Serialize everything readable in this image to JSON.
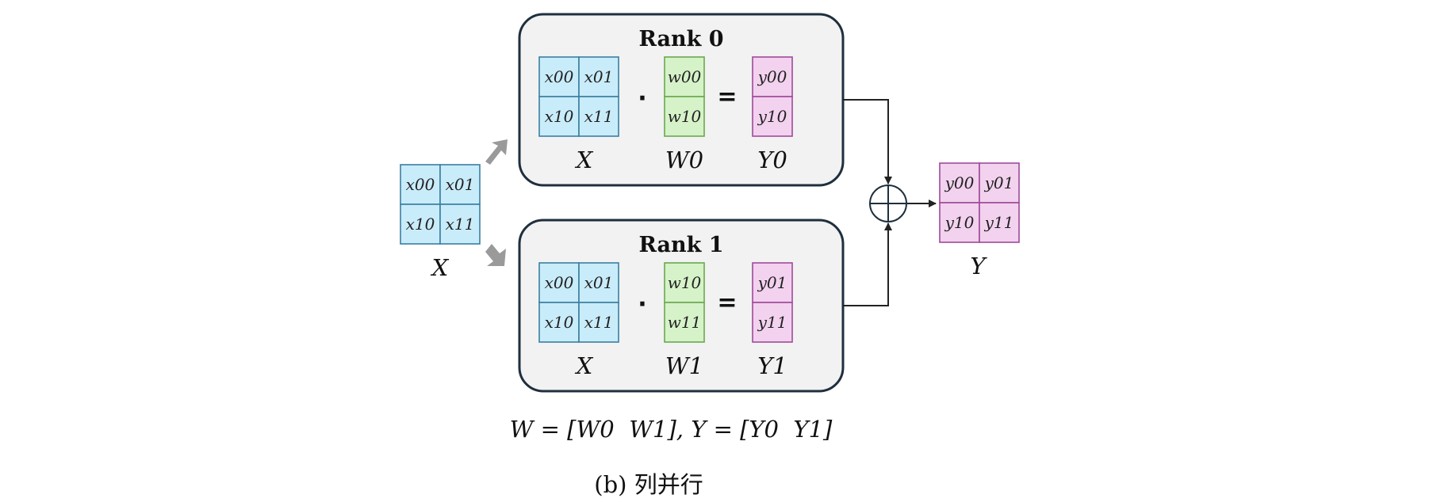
{
  "ranks": [
    {
      "title": "Rank 0",
      "x_cells": [
        "x00",
        "x01",
        "x10",
        "x11"
      ],
      "w_cells": [
        "w00",
        "w10"
      ],
      "y_cells": [
        "y00",
        "y10"
      ],
      "x_label": "X",
      "w_label": "W0",
      "y_label": "Y0"
    },
    {
      "title": "Rank 1",
      "x_cells": [
        "x00",
        "x01",
        "x10",
        "x11"
      ],
      "w_cells": [
        "w10",
        "w11"
      ],
      "y_cells": [
        "y01",
        "y11"
      ],
      "x_label": "X",
      "w_label": "W1",
      "y_label": "Y1"
    }
  ],
  "operators": {
    "dot": "·",
    "equals": "="
  },
  "input": {
    "cells": [
      "x00",
      "x01",
      "x10",
      "x11"
    ],
    "label": "X"
  },
  "output": {
    "cells": [
      "y00",
      "y01",
      "y10",
      "y11"
    ],
    "label": "Y"
  },
  "formula": "W = [W0  W1], Y = [Y0  Y1]",
  "caption": "(b) 列并行",
  "colors": {
    "x_fill": "#c9ecfa",
    "w_fill": "#d6f2c9",
    "y_fill": "#f2d2ef",
    "box_fill": "#f2f2f2",
    "arrow_gray": "#9a9a9a"
  }
}
